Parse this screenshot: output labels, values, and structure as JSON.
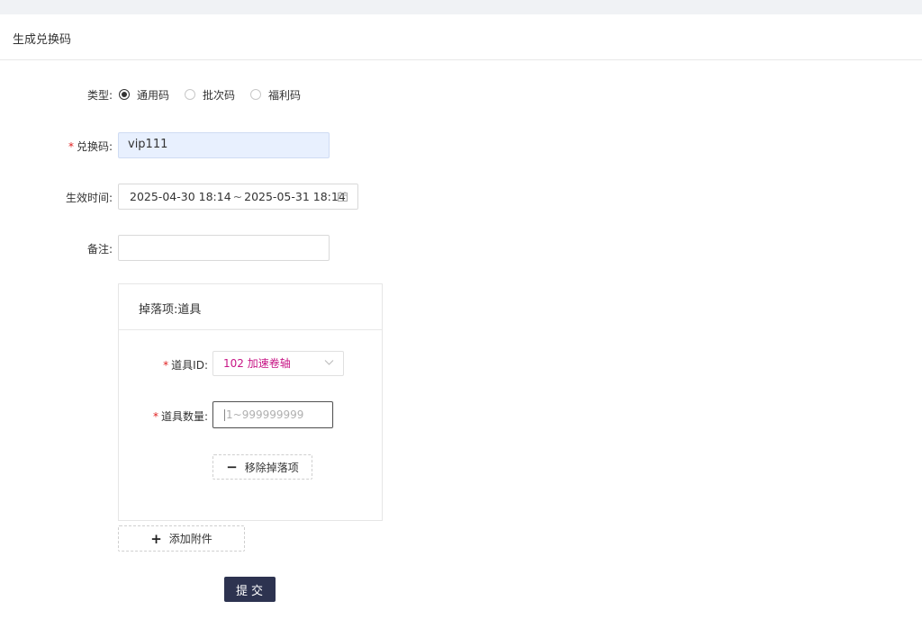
{
  "header": {
    "title": "生成兑换码"
  },
  "form": {
    "type": {
      "label": "类型:",
      "options": [
        {
          "label": "通用码",
          "checked": true
        },
        {
          "label": "批次码",
          "checked": false
        },
        {
          "label": "福利码",
          "checked": false
        }
      ]
    },
    "code": {
      "required_mark": "*",
      "label": "兑换码:",
      "value": "vip111"
    },
    "effective_time": {
      "label": "生效时间:",
      "start": "2025-04-30 18:14",
      "separator": "~",
      "end": "2025-05-31 18:14",
      "icon": "calendar-icon"
    },
    "remark": {
      "label": "备注:",
      "value": ""
    }
  },
  "drop_panel": {
    "title": "掉落项:道具",
    "item_id": {
      "required_mark": "*",
      "label": "道具ID:",
      "selected": "102 加速卷轴",
      "icon": "chevron-down-icon"
    },
    "item_count": {
      "required_mark": "*",
      "label": "道具数量:",
      "placeholder": "1~999999999"
    },
    "remove_button": {
      "symbol": "−",
      "label": "移除掉落项"
    }
  },
  "add_attachment": {
    "symbol": "+",
    "label": "添加附件"
  },
  "submit": {
    "label": "提交"
  },
  "colors": {
    "accent": "#2d3350",
    "select_text": "#c71585",
    "required": "#e02020",
    "filled_bg": "#e8f0fe"
  }
}
